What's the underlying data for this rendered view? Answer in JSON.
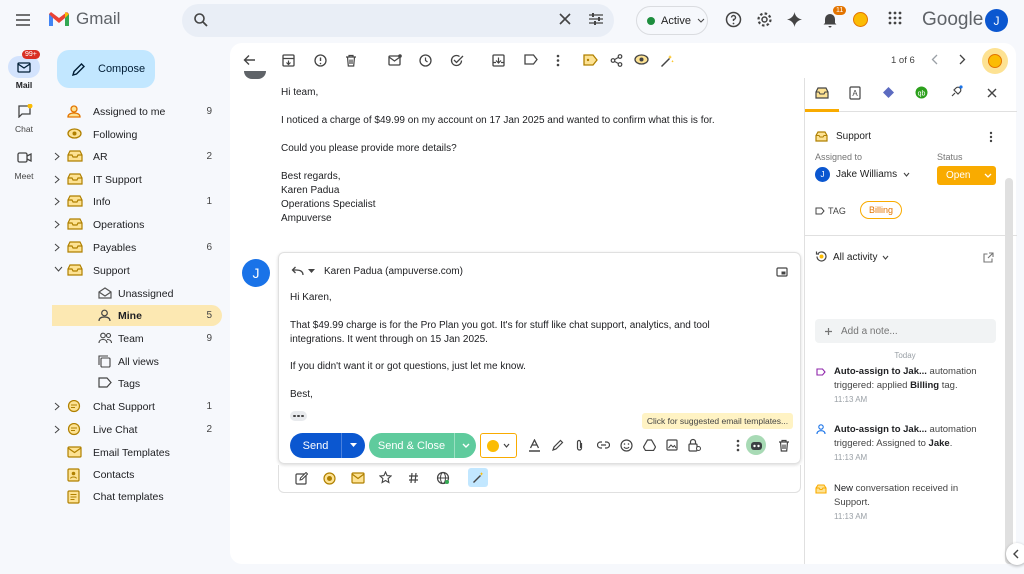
{
  "app": {
    "name": "Gmail",
    "brand_text": "Google",
    "user_initial": "J"
  },
  "status": {
    "label": "Active",
    "color": "#1e8e3e"
  },
  "notifications": {
    "count": "11"
  },
  "rail": {
    "mail_label": "Mail",
    "mail_badge": "99+",
    "chat_label": "Chat",
    "meet_label": "Meet"
  },
  "compose_label": "Compose",
  "sidebar": {
    "items": [
      {
        "label": "Assigned to me",
        "count": "9"
      },
      {
        "label": "Following",
        "count": ""
      },
      {
        "label": "AR",
        "count": "2"
      },
      {
        "label": "IT Support",
        "count": ""
      },
      {
        "label": "Info",
        "count": "1"
      },
      {
        "label": "Operations",
        "count": ""
      },
      {
        "label": "Payables",
        "count": "6"
      },
      {
        "label": "Support",
        "count": ""
      },
      {
        "label": "Unassigned",
        "count": ""
      },
      {
        "label": "Mine",
        "count": "5"
      },
      {
        "label": "Team",
        "count": "9"
      },
      {
        "label": "All views",
        "count": ""
      },
      {
        "label": "Tags",
        "count": ""
      },
      {
        "label": "Chat Support",
        "count": "1"
      },
      {
        "label": "Live Chat",
        "count": "2"
      },
      {
        "label": "Email Templates",
        "count": ""
      },
      {
        "label": "Contacts",
        "count": ""
      },
      {
        "label": "Chat templates",
        "count": ""
      }
    ]
  },
  "toolbar": {
    "pagination": "1 of 6"
  },
  "message": {
    "greeting": "Hi team,",
    "body1": "I noticed a charge of $49.99 on my account on 17 Jan 2025 and wanted to confirm what this is for.",
    "body2": "Could you please provide more details?",
    "sig1": "Best regards,",
    "sig2": "Karen Padua",
    "sig3": "Operations Specialist",
    "sig4": "Ampuverse"
  },
  "reply": {
    "avatar": "J",
    "to": "Karen Padua (ampuverse.com)",
    "greeting": "Hi Karen,",
    "body1": "That $49.99 charge is for the Pro Plan you got. It's for stuff like chat support, analytics, and tool integrations. It went through on 15 Jan 2025.",
    "body2": "If you didn't want it or got questions, just let me know.",
    "closing": "Best,",
    "send_label": "Send",
    "send_close_label": "Send & Close",
    "tooltip": "Click for suggested email templates..."
  },
  "panel": {
    "inbox_name": "Support",
    "assigned_label": "Assigned to",
    "assignee": "Jake Williams",
    "assignee_initial": "J",
    "status_label": "Status",
    "status_value": "Open",
    "tag_label": "TAG",
    "tag_chip": "Billing",
    "activity_label": "All activity",
    "note_placeholder": "Add a note...",
    "day_label": "Today",
    "activities": [
      {
        "title": "Auto-assign to Jak...",
        "kind": "automation",
        "pre": "triggered: applied ",
        "bold": "Billing",
        "post": " tag.",
        "time": "11:13 AM"
      },
      {
        "title": "Auto-assign to Jak...",
        "kind": "automation",
        "pre": "triggered: Assigned to ",
        "bold": "Jake",
        "post": ".",
        "time": "11:13 AM"
      },
      {
        "title": "New",
        "kind": "conversation received in",
        "pre": "",
        "bold": "",
        "post": "Support.",
        "time": "11:13 AM"
      }
    ]
  },
  "colors": {
    "accent": "#0b57d0",
    "send_close": "#5fcb9d",
    "status_open": "#f9ab00",
    "selected_item": "#fce8b2"
  }
}
